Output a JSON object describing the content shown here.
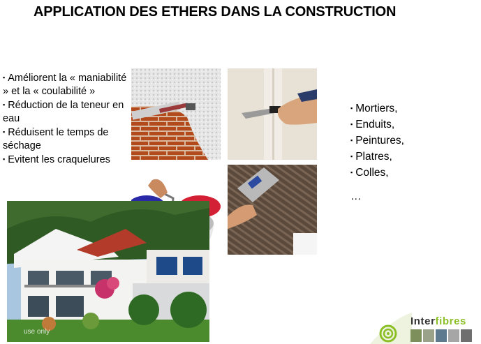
{
  "slide": {
    "title": "APPLICATION DES ETHERS DANS LA CONSTRUCTION",
    "benefits": [
      "Améliorent la « maniabilité » et la « coulabilité »",
      "Réduction de la teneur en eau",
      "Réduisent le temps de séchage",
      "Evitent les craquelures"
    ],
    "uses": [
      "Mortiers,",
      "Enduits,",
      "Peintures,",
      "Platres,",
      "Colles,"
    ],
    "uses_more": "…",
    "watermark": "use only",
    "logo": {
      "part1": "Inter",
      "part2": "fibres"
    },
    "bullet_glyph": "▪"
  },
  "colors": {
    "logo_green": "#8cbf26",
    "text": "#000000"
  }
}
